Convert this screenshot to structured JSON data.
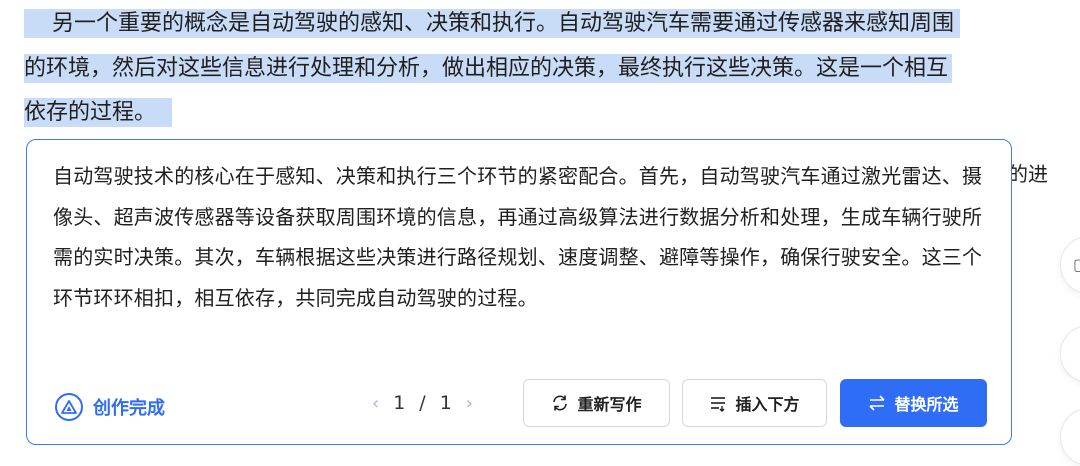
{
  "document": {
    "line1": "另一个重要的概念是自动驾驶的感知、决策和执行。自动驾驶汽车需要通过传感器来感知周围",
    "line2": "的环境，然后对这些信息进行处理和分析，做出相应的决策，最终执行这些决策。这是一个相互",
    "line3": "依存的过程。",
    "peek_text": "的进"
  },
  "panel": {
    "generated_text": "自动驾驶技术的核心在于感知、决策和执行三个环节的紧密配合。首先，自动驾驶汽车通过激光雷达、摄像头、超声波传感器等设备获取周围环境的信息，再通过高级算法进行数据分析和处理，生成车辆行驶所需的实时决策。其次，车辆根据这些决策进行路径规划、速度调整、避障等操作，确保行驶安全。这三个环节环环相扣，相互依存，共同完成自动驾驶的过程。",
    "status_label": "创作完成",
    "pager": {
      "current": "1",
      "separator": "/",
      "total": "1",
      "prev": "‹",
      "next": "›"
    },
    "buttons": {
      "rewrite": "重新写作",
      "insert_below": "插入下方",
      "replace_selection": "替换所选"
    }
  },
  "colors": {
    "accent": "#2f6df6",
    "selection_highlight": "#c9dcf7"
  }
}
